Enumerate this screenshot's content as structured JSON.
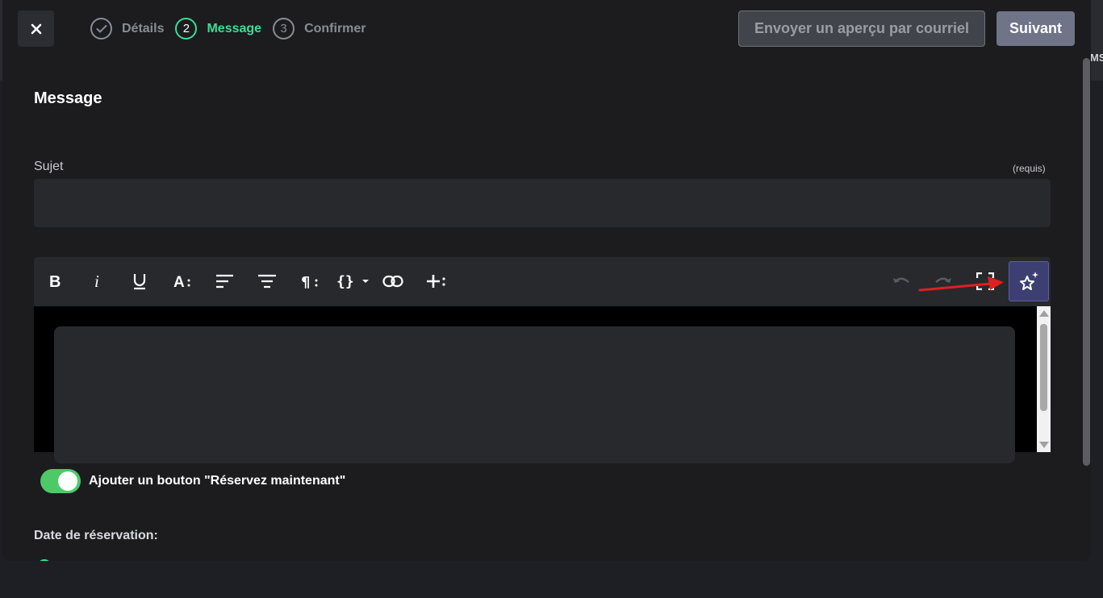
{
  "header": {
    "close_icon": "close-icon",
    "steps": [
      {
        "number": "",
        "label": "Détails",
        "state": "done"
      },
      {
        "number": "2",
        "label": "Message",
        "state": "active"
      },
      {
        "number": "3",
        "label": "Confirmer",
        "state": "upcoming"
      }
    ],
    "preview_label": "Envoyer un aperçu par courriel",
    "next_label": "Suivant"
  },
  "section": {
    "title": "Message"
  },
  "subject": {
    "label": "Sujet",
    "required_note": "(requis)",
    "value": ""
  },
  "toolbar": {
    "tools": [
      "bold-icon",
      "italic-icon",
      "underline-icon",
      "font-size-icon",
      "align-left-icon",
      "align-center-icon",
      "paragraph-icon",
      "variables-icon",
      "link-icon",
      "insert-icon"
    ],
    "actions": [
      "undo-icon",
      "redo-icon",
      "fullscreen-icon",
      "ai-sparkles-icon"
    ]
  },
  "toggle": {
    "label": "Ajouter un bouton \"Réservez maintenant\"",
    "on": true
  },
  "date": {
    "label": "Date de réservation:"
  },
  "background": {
    "right_text": "MS"
  },
  "colors": {
    "accent_green": "#3ddc97",
    "toggle_green": "#4ec968",
    "ai_button": "#3d3f73",
    "annotation_arrow": "#e02020"
  }
}
